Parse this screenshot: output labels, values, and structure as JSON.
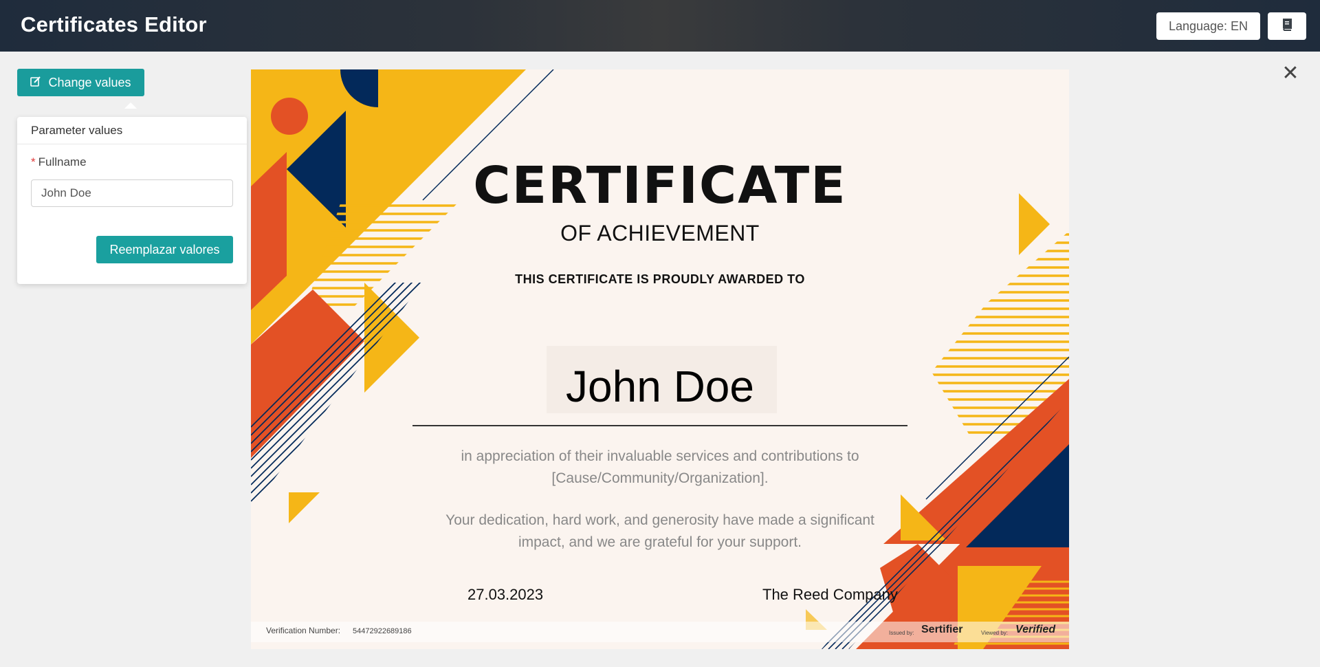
{
  "header": {
    "title": "Certificates Editor",
    "language_label": "Language: EN",
    "manual_icon": "book-icon"
  },
  "panel": {
    "change_values_label": "Change values",
    "change_values_icon": "edit-icon",
    "popover_title": "Parameter values",
    "field_label": "Fullname",
    "field_required_marker": "*",
    "field_value": "John Doe",
    "replace_button_label": "Reemplazar valores"
  },
  "close_icon": "close-icon",
  "certificate": {
    "title": "CERTIFICATE",
    "subtitle": "OF ACHIEVEMENT",
    "awarded_to": "THIS CERTIFICATE IS PROUDLY AWARDED TO",
    "recipient_name": "John Doe",
    "paragraph1": "in appreciation of their invaluable services and contributions to [Cause/Community/Organization].",
    "paragraph2": "Your dedication, hard work, and generosity have made a significant impact, and we are grateful for your support.",
    "date": "27.03.2023",
    "company": "The Reed Company",
    "verification_label": "Verification Number:",
    "verification_number": "54472922689186",
    "issued_by_label": "Issued by:",
    "issuer_name": "Sertifier",
    "viewed_by_label": "Viewed by:",
    "viewer_name": "Verified"
  },
  "colors": {
    "teal": "#1a9c9c",
    "yellow": "#f5b617",
    "orange": "#e35125",
    "navy": "#03295a",
    "cream": "#fbf4ef"
  }
}
